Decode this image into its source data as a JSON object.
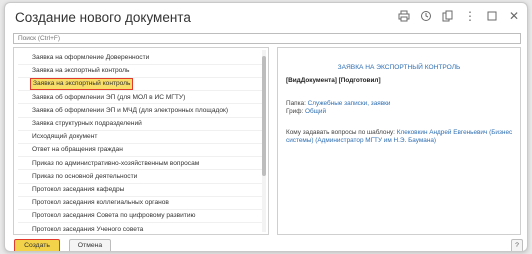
{
  "window": {
    "title": "Создание нового документа",
    "icons": [
      "printer-icon",
      "history-icon",
      "copy-icon",
      "more-icon",
      "maximize-icon",
      "close-icon"
    ]
  },
  "search": {
    "placeholder": "Поиск (Ctrl+F)"
  },
  "list": {
    "items": [
      "Заявка на оформление Доверенности",
      "Заявка на экспортный контроль",
      "Заявка на экспортный контроль",
      "Заявка об оформлении ЭП (для МОЛ в ИС МГТУ)",
      "Заявка об оформлении ЭП и МЧД (для электронных площадок)",
      "Заявка структурных подразделений",
      "Исходящий документ",
      "Ответ на обращения граждан",
      "Приказ по административно-хозяйственным вопросам",
      "Приказ по основной деятельности",
      "Протокол заседания кафедры",
      "Протокол заседания коллегиальных органов",
      "Протокол заседания Совета по цифровому развитию",
      "Протокол заседания Ученого совета"
    ],
    "selected_index": 2
  },
  "preview": {
    "title": "ЗАЯВКА НА ЭКСПОРТНЫЙ КОНТРОЛЬ",
    "header": "[ВидДокумента] [Подготовил]",
    "folder_label": "Папка:",
    "folder_value": "Служебные записки, заявки",
    "stamp_label": "Гриф:",
    "stamp_value": "Общий",
    "contact_label": "Кому задавать вопросы по шаблону:",
    "contact_value_1": "Клековкин Андрей Евгеньевич",
    "contact_value_2": "(Бизнес системы) (Администратор МГТУ им Н.Э. Баумана)"
  },
  "footer": {
    "create_label": "Создать",
    "cancel_label": "Отмена",
    "help_label": "?"
  },
  "colors": {
    "accent_yellow": "#f3d34a",
    "highlight_red": "#e23b2e",
    "link_blue": "#2f6fb3"
  }
}
